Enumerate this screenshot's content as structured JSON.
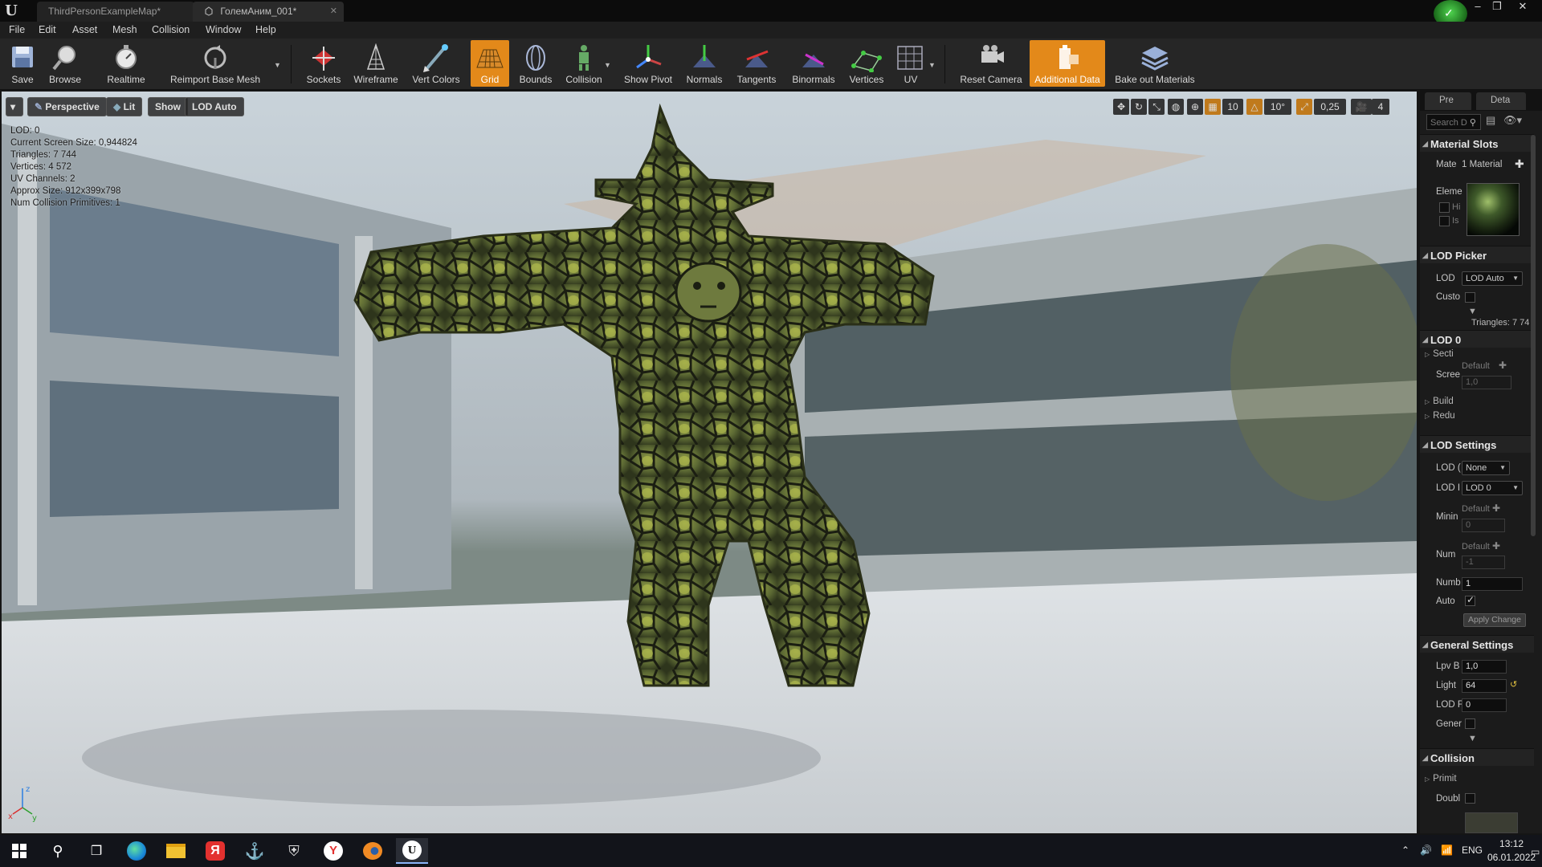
{
  "titlebar": {
    "tabs": [
      {
        "label": "ThirdPersonExampleMap*"
      },
      {
        "label": "ГолемАним_001*"
      }
    ]
  },
  "menu": [
    "File",
    "Edit",
    "Asset",
    "Mesh",
    "Collision",
    "Window",
    "Help"
  ],
  "toolbar": {
    "buttons": [
      {
        "label": "Save",
        "icon": "save-icon"
      },
      {
        "label": "Browse",
        "icon": "browse-icon"
      },
      {
        "label": "Realtime",
        "icon": "realtime-icon"
      },
      {
        "label": "Reimport Base Mesh",
        "icon": "reimport-icon"
      },
      {
        "label": "Sockets",
        "icon": "sockets-icon"
      },
      {
        "label": "Wireframe",
        "icon": "wireframe-icon"
      },
      {
        "label": "Vert Colors",
        "icon": "vert-colors-icon"
      },
      {
        "label": "Grid",
        "icon": "grid-icon",
        "active": true
      },
      {
        "label": "Bounds",
        "icon": "bounds-icon"
      },
      {
        "label": "Collision",
        "icon": "collision-icon"
      },
      {
        "label": "Show Pivot",
        "icon": "pivot-icon"
      },
      {
        "label": "Normals",
        "icon": "normals-icon"
      },
      {
        "label": "Tangents",
        "icon": "tangents-icon"
      },
      {
        "label": "Binormals",
        "icon": "binormals-icon"
      },
      {
        "label": "Vertices",
        "icon": "vertices-icon"
      },
      {
        "label": "UV",
        "icon": "uv-icon"
      },
      {
        "label": "Reset Camera",
        "icon": "reset-camera-icon"
      },
      {
        "label": "Additional Data",
        "icon": "additional-data-icon",
        "active": true
      },
      {
        "label": "Bake out Materials",
        "icon": "bake-materials-icon"
      }
    ],
    "accent": "#e3891a"
  },
  "viewport": {
    "perspective": "Perspective",
    "lit": "Lit",
    "show": "Show",
    "lod": "LOD Auto",
    "grid_snap": "10",
    "rot_snap": "10°",
    "scale_snap": "0,25",
    "cam_speed": "4",
    "stats": [
      "LOD:  0",
      "Current Screen Size:  0,944824",
      "Triangles:  7 744",
      "Vertices:  4 572",
      "UV Channels:  2",
      "Approx Size: 912x399x798",
      "Num Collision Primitives:  1"
    ]
  },
  "panel": {
    "tabs": [
      "Pre",
      "Deta"
    ],
    "search_placeholder": "Search D",
    "material_slots": {
      "title": "Material Slots",
      "label": "Mate",
      "count": "1 Material",
      "element": "Eleme",
      "hi": "Hi",
      "is": "Is"
    },
    "lod_picker": {
      "title": "LOD Picker",
      "lod_label": "LOD",
      "lod_value": "LOD Auto",
      "custom_label": "Custo",
      "triangles": "Triangles: 7 74"
    },
    "lod0": {
      "title": "LOD 0",
      "sections": "Secti",
      "screen": "Scree",
      "default": "Default",
      "screen_value": "1,0",
      "build": "Build",
      "reduce": "Redu"
    },
    "lod_settings": {
      "title": "LOD Settings",
      "group_label": "LOD (",
      "group_value": "None",
      "import_label": "LOD I",
      "import_value": "LOD 0",
      "min_label": "Minin",
      "default1": "Default",
      "min_value": "0",
      "num_label": "Num",
      "default2": "Default",
      "num_value": "-1",
      "numlods_label": "Numb",
      "numlods_value": "1",
      "auto_label": "Auto",
      "apply": "Apply Change"
    },
    "general": {
      "title": "General Settings",
      "lpv_label": "Lpv B",
      "lpv_value": "1,0",
      "light_label": "Light",
      "light_value": "64",
      "lodf_label": "LOD F",
      "lodf_value": "0",
      "gen_label": "Gener"
    },
    "collision": {
      "title": "Collision",
      "prim": "Primit",
      "double": "Doubl"
    }
  },
  "taskbar": {
    "lang": "ENG",
    "time": "13:12",
    "date": "06.01.2022"
  }
}
